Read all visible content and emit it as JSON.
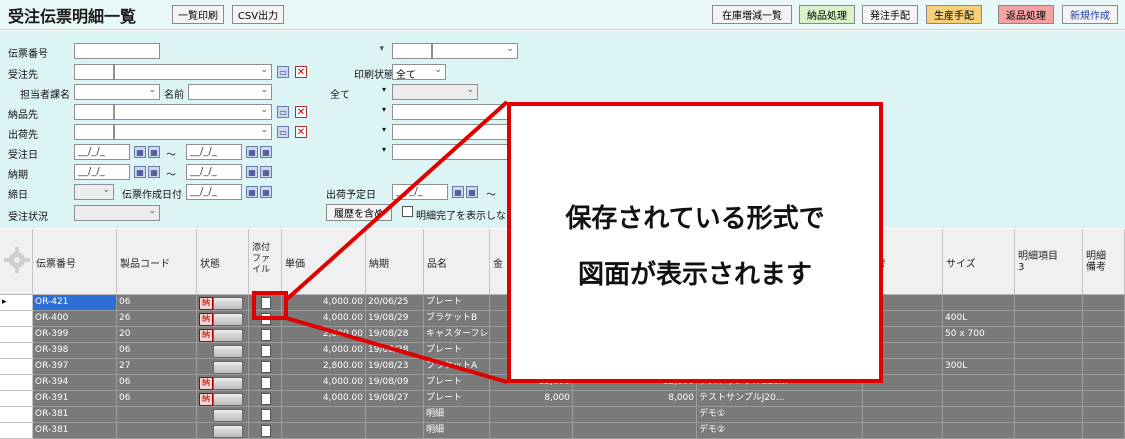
{
  "header": {
    "title": "受注伝票明細一覧",
    "print_list": "一覧印刷",
    "csv_output": "CSV出力",
    "right_buttons": [
      {
        "label": "在庫増減一覧",
        "bg": "#f4f4f4"
      },
      {
        "label": "納品処理",
        "bg": "#d9f2c9"
      },
      {
        "label": "発注手配",
        "bg": "#f4f4f4"
      },
      {
        "label": "生産手配",
        "bg": "#f7cf78"
      },
      {
        "label": "返品処理",
        "bg": "#f3a3a3"
      },
      {
        "label": "新規作成",
        "bg": "#f4f4f4"
      }
    ]
  },
  "filters": {
    "slip_no": "伝票番号",
    "customer": "受注先",
    "staff_dept": "担当者課名",
    "name": "名前",
    "delivery": "納品先",
    "shipping": "出荷先",
    "order_date": "受注日",
    "deadline": "納期",
    "close_date": "締日",
    "slip_created": "伝票作成日付",
    "order_status": "受注状況",
    "print_status": "印刷状態",
    "print_status_value": "全て",
    "all_value": "全て",
    "ship_date": "出荷予定日",
    "history_button": "履歴を含め",
    "hide_completed": "明細完了を表示しな",
    "date_placeholder": "__/_/_",
    "tilde": "～"
  },
  "callout": {
    "line1": "保存されている形式で",
    "line2": "図面が表示されます"
  },
  "grid": {
    "columns": [
      {
        "key": "slip",
        "label": "伝票番号"
      },
      {
        "key": "code",
        "label": "製品コード"
      },
      {
        "key": "status",
        "label": "状態"
      },
      {
        "key": "attach",
        "label": "添付ファイル"
      },
      {
        "key": "price",
        "label": "単価"
      },
      {
        "key": "due",
        "label": "納期"
      },
      {
        "key": "item",
        "label": "品名"
      },
      {
        "key": "amount",
        "label": "金"
      },
      {
        "key": "note",
        "label": "備考"
      },
      {
        "key": "size",
        "label": "サイズ"
      },
      {
        "key": "detail3",
        "label": "明細項目3"
      },
      {
        "key": "detailnote",
        "label": "明細備考"
      }
    ],
    "rows": [
      {
        "slip": "OR-421",
        "code": "06",
        "badge": "納",
        "price": "4,000.00",
        "due": "20/06/25",
        "item": "プレート",
        "amount": "",
        "amount2": "",
        "name2": "",
        "size": ""
      },
      {
        "slip": "OR-400",
        "code": "26",
        "badge": "納",
        "price": "4,000.00",
        "due": "19/08/29",
        "item": "ブラケットB",
        "amount": "",
        "amount2": "",
        "name2": "",
        "size": "400L"
      },
      {
        "slip": "OR-399",
        "code": "20",
        "badge": "納",
        "price": "2,000.00",
        "due": "19/08/28",
        "item": "キャスターフレ...",
        "amount": "",
        "amount2": "",
        "name2": "",
        "size": "50 x 700"
      },
      {
        "slip": "OR-398",
        "code": "06",
        "badge": "",
        "price": "4,000.00",
        "due": "19/08/28",
        "item": "プレート",
        "amount": "",
        "amount2": "",
        "name2": "",
        "size": ""
      },
      {
        "slip": "OR-397",
        "code": "27",
        "badge": "",
        "price": "2,800.00",
        "due": "19/08/23",
        "item": "ブラケットA",
        "amount": "",
        "amount2": "",
        "name2": "",
        "size": "300L"
      },
      {
        "slip": "OR-394",
        "code": "06",
        "badge": "納",
        "price": "4,000.00",
        "due": "19/08/09",
        "item": "プレート",
        "amount": "12,000",
        "amount2": "12,000",
        "name2": "テストサンプルB20...",
        "size": ""
      },
      {
        "slip": "OR-391",
        "code": "06",
        "badge": "納",
        "price": "4,000.00",
        "due": "19/08/27",
        "item": "プレート",
        "amount": "8,000",
        "amount2": "8,000",
        "name2": "テストサンプルJ20...",
        "size": ""
      },
      {
        "slip": "OR-381",
        "code": "",
        "badge": "",
        "price": "",
        "due": "",
        "item": "明細",
        "amount": "",
        "amount2": "",
        "name2": "デモ①",
        "size": ""
      },
      {
        "slip": "OR-381",
        "code": "",
        "badge": "",
        "price": "",
        "due": "",
        "item": "明細",
        "amount": "",
        "amount2": "",
        "name2": "デモ②",
        "size": ""
      }
    ]
  }
}
